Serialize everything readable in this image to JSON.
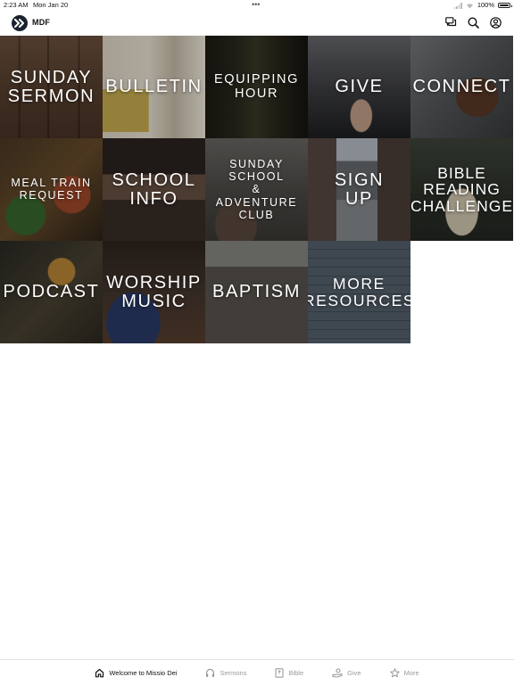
{
  "status_bar": {
    "time": "2:23 AM",
    "date": "Mon Jan 20",
    "battery": "100%"
  },
  "header": {
    "title": "MDF",
    "logo_icon": "double-chevron-right-icon",
    "actions": [
      {
        "name": "chat-icon"
      },
      {
        "name": "search-icon"
      },
      {
        "name": "account-icon"
      }
    ]
  },
  "tiles": [
    {
      "label": "SUNDAY\nSERMON"
    },
    {
      "label": "BULLETIN"
    },
    {
      "label": "EQUIPPING\nHOUR"
    },
    {
      "label": "GIVE"
    },
    {
      "label": "CONNECT"
    },
    {
      "label": "MEAL TRAIN\nREQUEST"
    },
    {
      "label": "SCHOOL\nINFO"
    },
    {
      "label": "SUNDAY\nSCHOOL\n&\nADVENTURE\nCLUB"
    },
    {
      "label": "SIGN\nUP"
    },
    {
      "label": "BIBLE\nREADING\nCHALLENGE"
    },
    {
      "label": "PODCAST"
    },
    {
      "label": "WORSHIP\nMUSIC"
    },
    {
      "label": "BAPTISM"
    },
    {
      "label": "MORE\nRESOURCES"
    }
  ],
  "tab_bar": {
    "tabs": [
      {
        "label": "Welcome to Missio Dei",
        "icon": "home-icon",
        "active": true
      },
      {
        "label": "Sermons",
        "icon": "headphones-icon",
        "active": false
      },
      {
        "label": "Bible",
        "icon": "bible-icon",
        "active": false
      },
      {
        "label": "Give",
        "icon": "give-hand-icon",
        "active": false
      },
      {
        "label": "More",
        "icon": "star-icon",
        "active": false
      }
    ]
  }
}
